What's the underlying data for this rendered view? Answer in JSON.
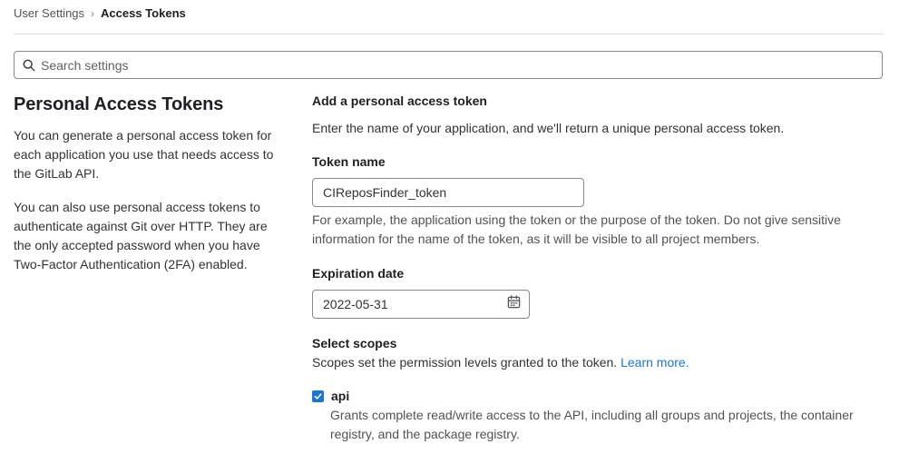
{
  "breadcrumb": {
    "parent": "User Settings",
    "separator": "›",
    "current": "Access Tokens"
  },
  "search": {
    "icon": "search-icon",
    "placeholder": "Search settings",
    "value": ""
  },
  "left": {
    "title": "Personal Access Tokens",
    "paragraph1": "You can generate a personal access token for each application you use that needs access to the GitLab API.",
    "paragraph2": "You can also use personal access tokens to authenticate against Git over HTTP. They are the only accepted password when you have Two-Factor Authentication (2FA) enabled."
  },
  "form": {
    "heading": "Add a personal access token",
    "description": "Enter the name of your application, and we'll return a unique personal access token.",
    "token_name": {
      "label": "Token name",
      "value": "CIReposFinder_token",
      "help": "For example, the application using the token or the purpose of the token. Do not give sensitive information for the name of the token, as it will be visible to all project members."
    },
    "expiration": {
      "label": "Expiration date",
      "value": "2022-05-31",
      "icon": "calendar-icon"
    },
    "scopes": {
      "label": "Select scopes",
      "description": "Scopes set the permission levels granted to the token.",
      "learn_more": "Learn more.",
      "items": [
        {
          "name": "api",
          "checked": true,
          "description": "Grants complete read/write access to the API, including all groups and projects, the container registry, and the package registry."
        }
      ]
    }
  },
  "colors": {
    "accent": "#1f75cb",
    "border": "#89888d",
    "divider": "#dcdcde",
    "text": "#333238"
  }
}
